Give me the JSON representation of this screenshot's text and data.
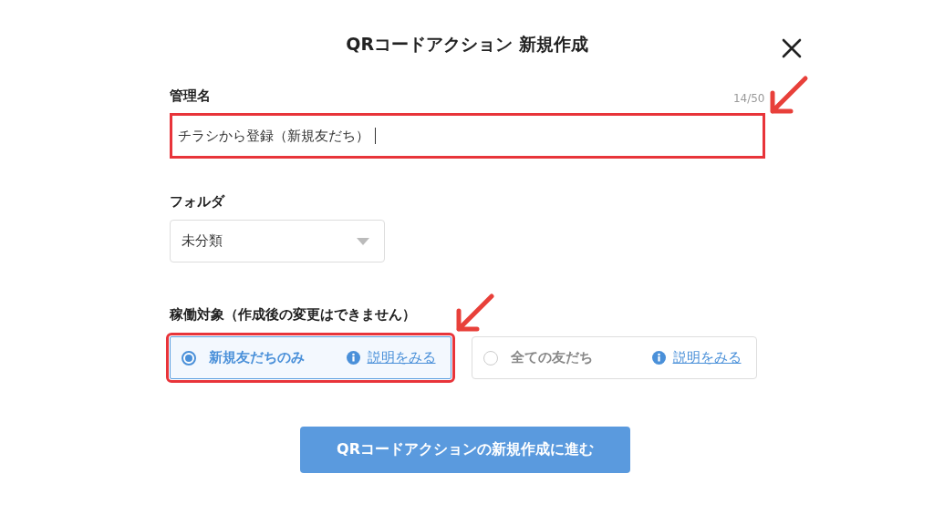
{
  "dialog": {
    "title": "QRコードアクション 新規作成"
  },
  "name_field": {
    "label": "管理名",
    "counter": "14/50",
    "value": "チラシから登録（新規友だち）",
    "highlighted": true
  },
  "folder_field": {
    "label": "フォルダ",
    "value": "未分類"
  },
  "target": {
    "label": "稼働対象（作成後の変更はできません）",
    "options": [
      {
        "label": "新規友だちのみ",
        "link": "説明をみる",
        "selected": true,
        "highlighted": true
      },
      {
        "label": "全ての友だち",
        "link": "説明をみる",
        "selected": false,
        "highlighted": false
      }
    ]
  },
  "submit_button": {
    "label": "QRコードアクションの新規作成に進む"
  }
}
